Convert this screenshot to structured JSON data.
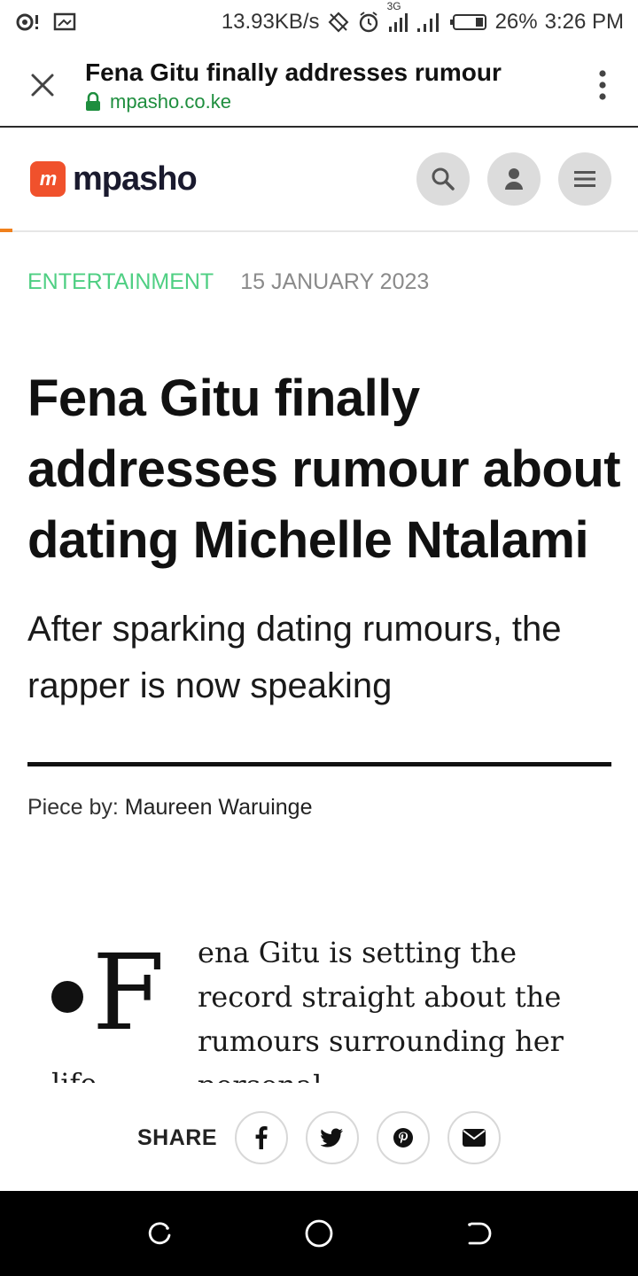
{
  "status_bar": {
    "speed": "13.93KB/s",
    "network_label": "3G",
    "battery": "26%",
    "time": "3:26 PM"
  },
  "browser": {
    "page_title": "Fena Gitu finally addresses rumour",
    "url": "mpasho.co.ke"
  },
  "site": {
    "logo_mark": "m",
    "logo_text": "mpasho"
  },
  "article": {
    "category": "ENTERTAINMENT",
    "date": "15 JANUARY 2023",
    "headline": "Fena Gitu finally addresses rumour about dating Michelle Ntalami",
    "subheadline": "After sparking dating rumours, the rapper is now speaking",
    "byline_label": "Piece by:",
    "author": "Maureen Waruinge",
    "dropcap": "F",
    "body_text": "ena Gitu is setting the record straight about the rumours surrounding her personal",
    "body_tail": "life"
  },
  "share": {
    "label": "SHARE",
    "buttons": [
      "facebook-icon",
      "twitter-icon",
      "pinterest-icon",
      "email-icon"
    ]
  },
  "colors": {
    "category": "#4fcf83",
    "logo": "#f0512c",
    "url": "#1e8e3e"
  }
}
